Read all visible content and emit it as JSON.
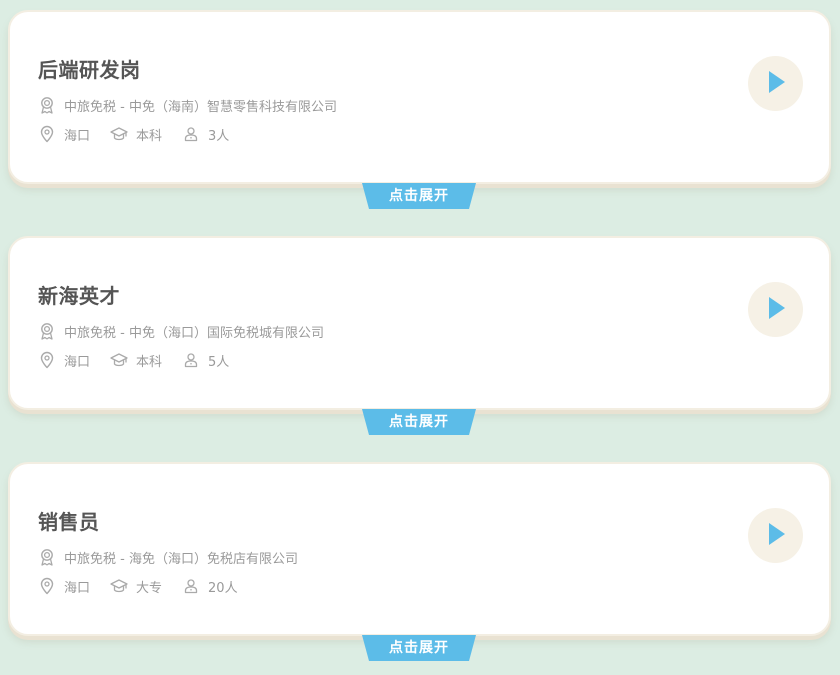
{
  "theme": {
    "background": "#dcede3",
    "card_bg": "#ffffff",
    "accent_blue": "#5cbce8",
    "play_bg": "#f6f1e6",
    "icon_gray": "#aaaaaa"
  },
  "jobs": [
    {
      "title": "后端研发岗",
      "company": "中旅免税 - 中免（海南）智慧零售科技有限公司",
      "location": "海口",
      "education": "本科",
      "headcount": "3人",
      "expand_label": "点击展开"
    },
    {
      "title": "新海英才",
      "company": "中旅免税 - 中免（海口）国际免税城有限公司",
      "location": "海口",
      "education": "本科",
      "headcount": "5人",
      "expand_label": "点击展开"
    },
    {
      "title": "销售员",
      "company": "中旅免税 - 海免（海口）免税店有限公司",
      "location": "海口",
      "education": "大专",
      "headcount": "20人",
      "expand_label": "点击展开"
    }
  ],
  "icons": {
    "company": "award-icon",
    "location": "location-pin-icon",
    "education": "graduation-cap-icon",
    "headcount": "person-icon",
    "play": "play-icon"
  }
}
